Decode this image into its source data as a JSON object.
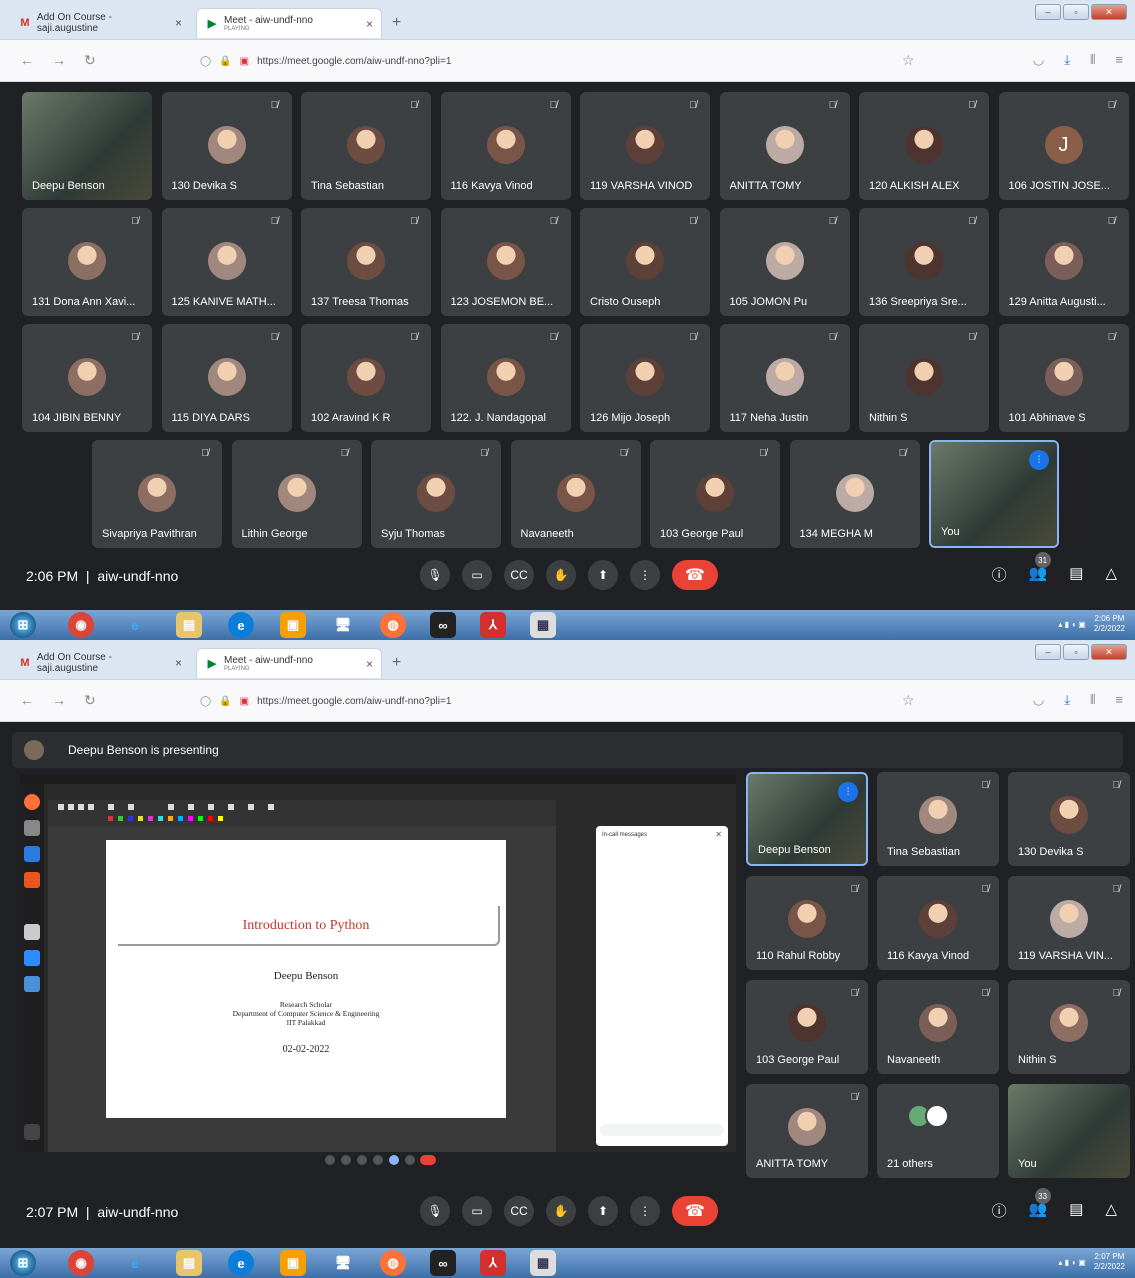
{
  "browser": {
    "tabs": [
      {
        "title": "Add On Course - saji.augustine",
        "sub": ""
      },
      {
        "title": "Meet - aiw-undf-nno",
        "sub": "PLAYING"
      }
    ],
    "url": "https://meet.google.com/aiw-undf-nno?pli=1",
    "new_tab": "+",
    "close": "×"
  },
  "screen1": {
    "tiles": [
      {
        "name": "Deepu Benson",
        "video": true
      },
      {
        "name": "130 Devika S",
        "muted": true
      },
      {
        "name": "Tina Sebastian",
        "muted": true
      },
      {
        "name": "116 Kavya Vinod",
        "muted": true
      },
      {
        "name": "119 VARSHA VINOD",
        "muted": true
      },
      {
        "name": "ANITTA TOMY",
        "muted": true
      },
      {
        "name": "120 ALKISH ALEX",
        "muted": true
      },
      {
        "name": "106 JOSTIN JOSE...",
        "muted": true,
        "letter": "J"
      },
      {
        "name": "131 Dona Ann Xavi...",
        "muted": true
      },
      {
        "name": "125 KANIVE MATH...",
        "muted": true
      },
      {
        "name": "137 Treesa Thomas",
        "muted": true
      },
      {
        "name": "123 JOSEMON BE...",
        "muted": true
      },
      {
        "name": "Cristo Ouseph",
        "muted": true
      },
      {
        "name": "105 JOMON Pu",
        "muted": true
      },
      {
        "name": "136 Sreepriya Sre...",
        "muted": true
      },
      {
        "name": "129 Anitta Augusti...",
        "muted": true
      },
      {
        "name": "104 JIBIN BENNY",
        "muted": true
      },
      {
        "name": "115 DIYA DARS",
        "muted": true
      },
      {
        "name": "102 Aravind K R",
        "muted": true
      },
      {
        "name": "122. J. Nandagopal",
        "muted": true
      },
      {
        "name": "126 Mijo Joseph",
        "muted": true
      },
      {
        "name": "117 Neha Justin",
        "muted": true
      },
      {
        "name": "Nithin S",
        "muted": true
      },
      {
        "name": "101 Abhinave S",
        "muted": true
      },
      {
        "name": "Sivapriya Pavithran",
        "muted": true
      },
      {
        "name": "Lithin George",
        "muted": true
      },
      {
        "name": "Syju Thomas",
        "muted": true
      },
      {
        "name": "Navaneeth",
        "muted": true
      },
      {
        "name": "103 George Paul",
        "muted": true
      },
      {
        "name": "134 MEGHA M",
        "muted": true
      },
      {
        "name": "You",
        "video": true
      }
    ],
    "time": "2:06 PM",
    "meeting_code": "aiw-undf-nno",
    "participants_badge": "31",
    "clock_time": "2:06 PM",
    "clock_date": "2/2/2022"
  },
  "screen2": {
    "presenting": "Deepu Benson is presenting",
    "slide": {
      "title": "Introduction to Python",
      "author": "Deepu Benson",
      "role": "Research Scholar",
      "dept": "Department of Computer Science & Engineering",
      "inst": "IIT Palakkad",
      "date": "02-02-2022"
    },
    "chat_title": "In-call messages",
    "tiles": [
      {
        "name": "Deepu Benson",
        "video": true
      },
      {
        "name": "Tina Sebastian",
        "muted": true
      },
      {
        "name": "130 Devika S",
        "muted": true
      },
      {
        "name": "110 Rahul Robby",
        "muted": true
      },
      {
        "name": "116 Kavya Vinod",
        "muted": true
      },
      {
        "name": "119 VARSHA VIN...",
        "muted": true
      },
      {
        "name": "103 George Paul",
        "muted": true
      },
      {
        "name": "Navaneeth",
        "muted": true
      },
      {
        "name": "Nithin S",
        "muted": true
      },
      {
        "name": "ANITTA TOMY",
        "muted": true
      },
      {
        "name": "21 others"
      },
      {
        "name": "You",
        "video": true
      }
    ],
    "time": "2:07 PM",
    "meeting_code": "aiw-undf-nno",
    "participants_badge": "33",
    "clock_time": "2:07 PM",
    "clock_date": "2/2/2022"
  },
  "colors": {
    "end_call": "#ea4335",
    "tile": "#3c4043",
    "bg": "#202124",
    "accent": "#1a73e8"
  }
}
